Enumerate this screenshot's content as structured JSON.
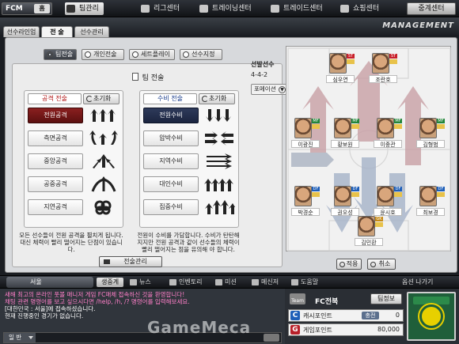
{
  "nav": {
    "logo": "FCM",
    "home": "홈",
    "items": [
      "팀관리",
      "리그센터",
      "트레이닝센터",
      "트레이드센터",
      "쇼핑센터"
    ],
    "contract": "중계센터"
  },
  "header": {
    "title": "MANAGEMENT"
  },
  "subtabs": [
    "선수라인업",
    "전 술",
    "선수관리"
  ],
  "tactic_tabs": [
    "팀전술",
    "개인전술",
    "세트플레이",
    "선수지정"
  ],
  "team_tactic_title": "팀 전술",
  "attack": {
    "label": "공격 전술",
    "reset": "초기화",
    "options": [
      "전원공격",
      "측면공격",
      "중앙공격",
      "공중공격",
      "지연공격"
    ],
    "desc": "모든 선수들이 전원 공격을 펼치게 됩니다. 대신 체력이 빨리 떨어지는 단점이 있습니다."
  },
  "defense": {
    "label": "수비 전술",
    "reset": "초기화",
    "options": [
      "전원수비",
      "압박수비",
      "지역수비",
      "대인수비",
      "집중수비"
    ],
    "desc": "전원이 수비를 가담합니다. 수비가 탄탄해지지만 전원 공격과 같이 선수들의 체력이 빨리 떨어지는 점을 유의해 야 합니다."
  },
  "tactic_manage": "전술관리",
  "formation": {
    "label": "선발선수",
    "value": "4-4-2",
    "select": "포메이션"
  },
  "players": [
    {
      "name": "심우연",
      "pos": "ST"
    },
    {
      "name": "조란호",
      "pos": "ST"
    },
    {
      "name": "이광진",
      "pos": "MF"
    },
    {
      "name": "황보원",
      "pos": "MF"
    },
    {
      "name": "이중관",
      "pos": "MF"
    },
    {
      "name": "김형범",
      "pos": "MF"
    },
    {
      "name": "박경순",
      "pos": "DF"
    },
    {
      "name": "권오성",
      "pos": "DF"
    },
    {
      "name": "윤시호",
      "pos": "DF"
    },
    {
      "name": "최보경",
      "pos": "DF"
    },
    {
      "name": "김민환",
      "pos": "GK"
    }
  ],
  "buttons": {
    "apply": "적용",
    "cancel": "취소"
  },
  "bottom": {
    "channel": "서울",
    "items": [
      "생중계",
      "뉴스",
      "인벤토리",
      "미션",
      "메신저",
      "도움말"
    ],
    "right": "옵션 나가기"
  },
  "chat": {
    "lines": [
      "새해 최고의 온라인 풋볼 매니저 게임 FC매체 접속하신 것을 환영합니다!",
      "채팅 관련 명령어를 보고 싶으시다면 /help, /h, /? 명령어를 입력해보세요.",
      "[대한민국 : 서울]에 접속하셨습니다.",
      "현재 진행중인 경기가 없습니다."
    ],
    "mode": "일 반"
  },
  "team": {
    "icon_label": "Team",
    "name": "FC전북",
    "detail": "팀정보",
    "points": [
      {
        "badge": "C",
        "label": "캐시포인트",
        "value": "0",
        "btn": "충전",
        "color": "#1f5fb8"
      },
      {
        "badge": "G",
        "label": "게임포인트",
        "value": "80,000",
        "btn": "",
        "color": "#b8202a"
      }
    ]
  },
  "watermark": "GameMeca"
}
